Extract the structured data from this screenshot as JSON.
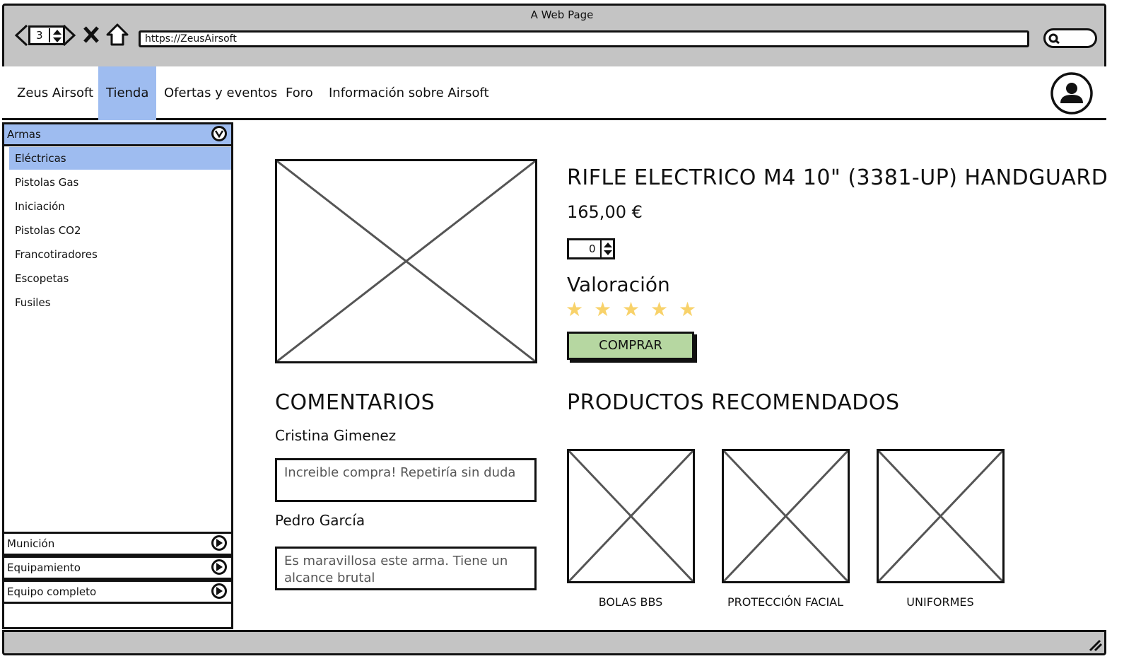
{
  "browser": {
    "title": "A Web Page",
    "tab_count": "3",
    "url": "https://ZeusAirsoft"
  },
  "nav": {
    "items": [
      "Zeus Airsoft",
      "Tienda",
      "Ofertas y eventos",
      "Foro",
      "Información sobre Airsoft"
    ],
    "active": "Tienda"
  },
  "sidebar": {
    "sections": [
      {
        "label": "Armas",
        "open": true
      },
      {
        "label": "Munición",
        "open": false
      },
      {
        "label": "Equipamiento",
        "open": false
      },
      {
        "label": "Equipo completo",
        "open": false
      }
    ],
    "armas_items": [
      "Eléctricas",
      "Pistolas Gas",
      "Iniciación",
      "Pistolas CO2",
      "Francotiradores",
      "Escopetas",
      "Fusiles"
    ],
    "selected": "Eléctricas"
  },
  "product": {
    "name": "RIFLE ELECTRICO M4 10\" (3381-UP) HANDGUARD",
    "price": "165,00 €",
    "quantity": "0",
    "rating_title": "Valoración",
    "rating_stars": 5,
    "buy_label": "COMPRAR"
  },
  "comments": {
    "title": "COMENTARIOS",
    "list": [
      {
        "author": "Cristina Gimenez",
        "text": "Increible compra! Repetiría sin duda"
      },
      {
        "author": "Pedro García",
        "text": "Es maravillosa este arma. Tiene un alcance brutal"
      }
    ]
  },
  "recommended": {
    "title": "PRODUCTOS RECOMENDADOS",
    "items": [
      "BOLAS BBS",
      "PROTECCIÓN FACIAL",
      "UNIFORMES"
    ]
  },
  "colors": {
    "highlight": "#9ebcf0",
    "buy_button": "#b6d7a1",
    "star": "#f8d26a",
    "frame": "#c4c4c4"
  }
}
